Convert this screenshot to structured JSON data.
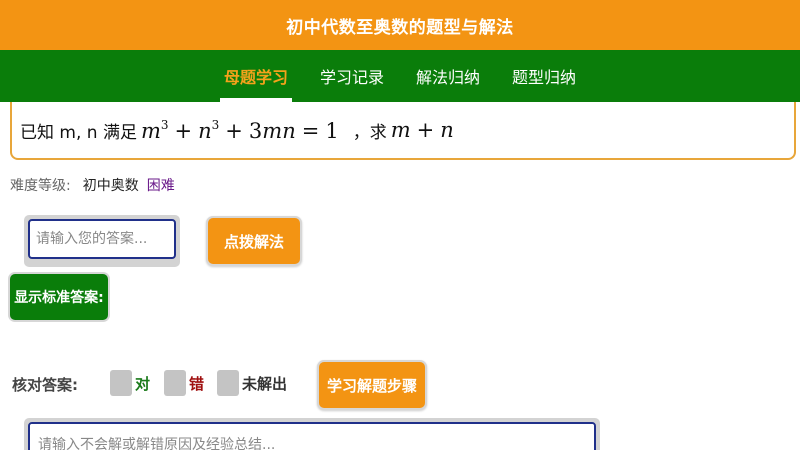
{
  "app": {
    "title": "初中代数至奥数的题型与解法"
  },
  "nav": {
    "tabs": [
      {
        "label": "母题学习",
        "active": true
      },
      {
        "label": "学习记录",
        "active": false
      },
      {
        "label": "解法归纳",
        "active": false
      },
      {
        "label": "题型归纳",
        "active": false
      }
    ]
  },
  "question": {
    "prefix": "已知 m, n 满足",
    "equation": {
      "a": "m",
      "b": "n",
      "exp": "3",
      "op_plus": "+",
      "coef": "3",
      "mn": "mn",
      "eq": "=",
      "rhs": "1"
    },
    "ask": "，求",
    "target": {
      "a": "m",
      "op": "+",
      "b": "n"
    }
  },
  "difficulty": {
    "label": "难度等级:",
    "level": "初中奥数",
    "tag": "困难"
  },
  "answer": {
    "placeholder": "请输入您的答案..."
  },
  "buttons": {
    "hint": "点拨解法",
    "show_answer": "显示标准答案:",
    "steps": "学习解题步骤"
  },
  "check": {
    "label": "核对答案:",
    "options": {
      "right": "对",
      "wrong": "错",
      "unsolved": "未解出"
    }
  },
  "notes": {
    "placeholder": "请输入不会解或解错原因及经验总结..."
  },
  "colors": {
    "orange": "#f39413",
    "green": "#0a7d0a",
    "purple": "#6a1a8a"
  }
}
